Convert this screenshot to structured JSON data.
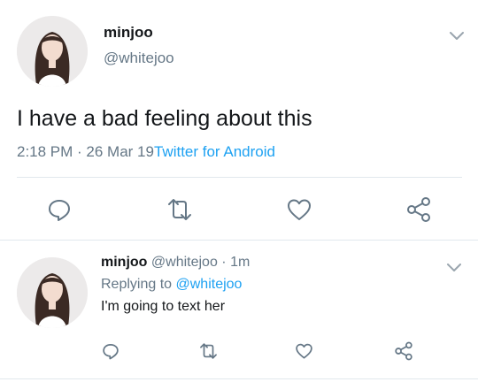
{
  "main_tweet": {
    "display_name": "minjoo",
    "handle": "@whitejoo",
    "text": "I have a bad feeling about this",
    "time": "2:18 PM",
    "separator": " · ",
    "date": "26 Mar 19",
    "source": "Twitter for Android"
  },
  "reply_tweet": {
    "display_name": "minjoo",
    "handle": "@whitejoo",
    "age": "· 1m",
    "replying_prefix": "Replying to",
    "replying_to": "@whitejoo",
    "text": "I'm going to text her"
  },
  "icons": {
    "actions": [
      "reply-icon",
      "retweet-icon",
      "like-icon",
      "share-icon"
    ],
    "menu": "chevron-down-icon"
  },
  "colors": {
    "link": "#1da1f2",
    "muted": "#657786",
    "icon": "#657786",
    "divider": "#e1e8ed"
  }
}
